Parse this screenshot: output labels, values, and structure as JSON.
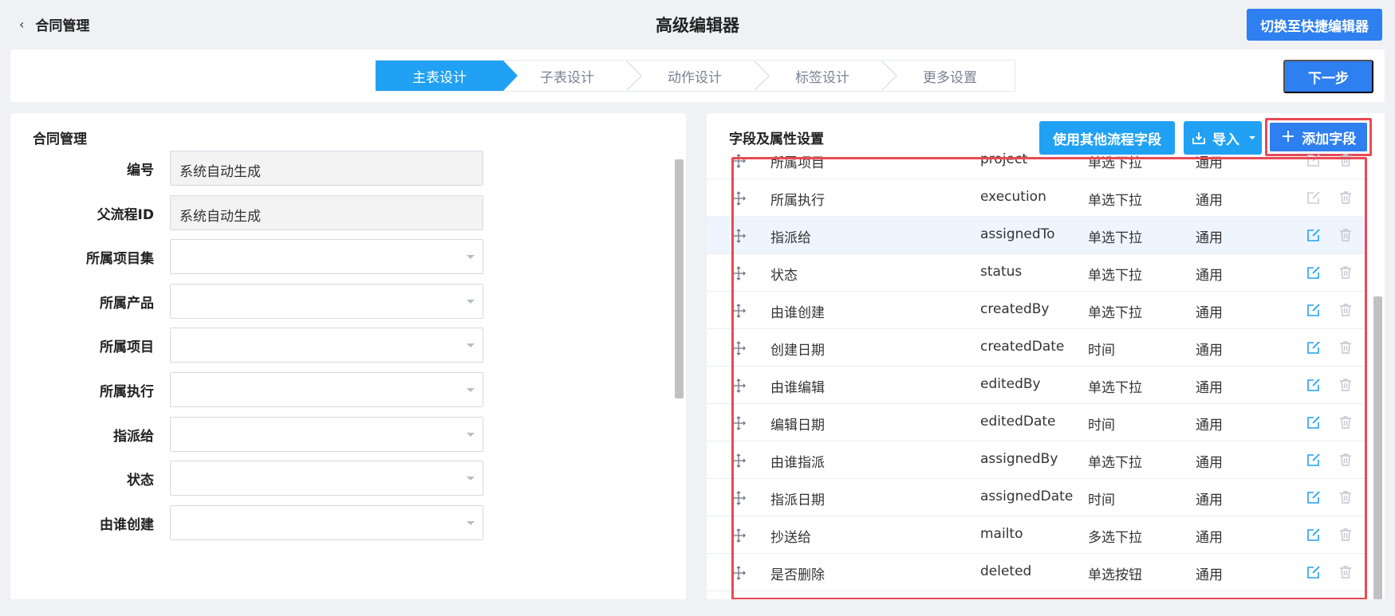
{
  "header": {
    "back_label": "合同管理",
    "title": "高级编辑器",
    "switch_button": "切换至快捷编辑器"
  },
  "steps": [
    "主表设计",
    "子表设计",
    "动作设计",
    "标签设计",
    "更多设置"
  ],
  "active_step": "主表设计",
  "next_button": "下一步",
  "left_panel": {
    "title": "合同管理",
    "fields": [
      {
        "label": "编号",
        "value": "系统自动生成",
        "type": "readonly"
      },
      {
        "label": "父流程ID",
        "value": "系统自动生成",
        "type": "readonly"
      },
      {
        "label": "所属项目集",
        "value": "",
        "type": "select"
      },
      {
        "label": "所属产品",
        "value": "",
        "type": "select"
      },
      {
        "label": "所属项目",
        "value": "",
        "type": "select"
      },
      {
        "label": "所属执行",
        "value": "",
        "type": "select"
      },
      {
        "label": "指派给",
        "value": "",
        "type": "select"
      },
      {
        "label": "状态",
        "value": "",
        "type": "select"
      },
      {
        "label": "由谁创建",
        "value": "",
        "type": "select"
      }
    ]
  },
  "right_panel": {
    "title": "字段及属性设置",
    "buttons": {
      "use_other": "使用其他流程字段",
      "import": "导入",
      "add_field": "添加字段"
    },
    "rows": [
      {
        "name": "所属项目",
        "code": "project",
        "control": "单选下拉",
        "scope": "通用",
        "editable": false,
        "highlight": false
      },
      {
        "name": "所属执行",
        "code": "execution",
        "control": "单选下拉",
        "scope": "通用",
        "editable": false,
        "highlight": false
      },
      {
        "name": "指派给",
        "code": "assignedTo",
        "control": "单选下拉",
        "scope": "通用",
        "editable": true,
        "highlight": true
      },
      {
        "name": "状态",
        "code": "status",
        "control": "单选下拉",
        "scope": "通用",
        "editable": true,
        "highlight": false
      },
      {
        "name": "由谁创建",
        "code": "createdBy",
        "control": "单选下拉",
        "scope": "通用",
        "editable": true,
        "highlight": false
      },
      {
        "name": "创建日期",
        "code": "createdDate",
        "control": "时间",
        "scope": "通用",
        "editable": true,
        "highlight": false
      },
      {
        "name": "由谁编辑",
        "code": "editedBy",
        "control": "单选下拉",
        "scope": "通用",
        "editable": true,
        "highlight": false
      },
      {
        "name": "编辑日期",
        "code": "editedDate",
        "control": "时间",
        "scope": "通用",
        "editable": true,
        "highlight": false
      },
      {
        "name": "由谁指派",
        "code": "assignedBy",
        "control": "单选下拉",
        "scope": "通用",
        "editable": true,
        "highlight": false
      },
      {
        "name": "指派日期",
        "code": "assignedDate",
        "control": "时间",
        "scope": "通用",
        "editable": true,
        "highlight": false
      },
      {
        "name": "抄送给",
        "code": "mailto",
        "control": "多选下拉",
        "scope": "通用",
        "editable": true,
        "highlight": false
      },
      {
        "name": "是否删除",
        "code": "deleted",
        "control": "单选按钮",
        "scope": "通用",
        "editable": true,
        "highlight": false
      }
    ]
  },
  "colors": {
    "primary": "#2e7ff0",
    "active_step": "#21a1f3",
    "annotation": "#e84a55",
    "edit_icon": "#21a1f3",
    "disabled_icon": "#c8ccd3"
  }
}
